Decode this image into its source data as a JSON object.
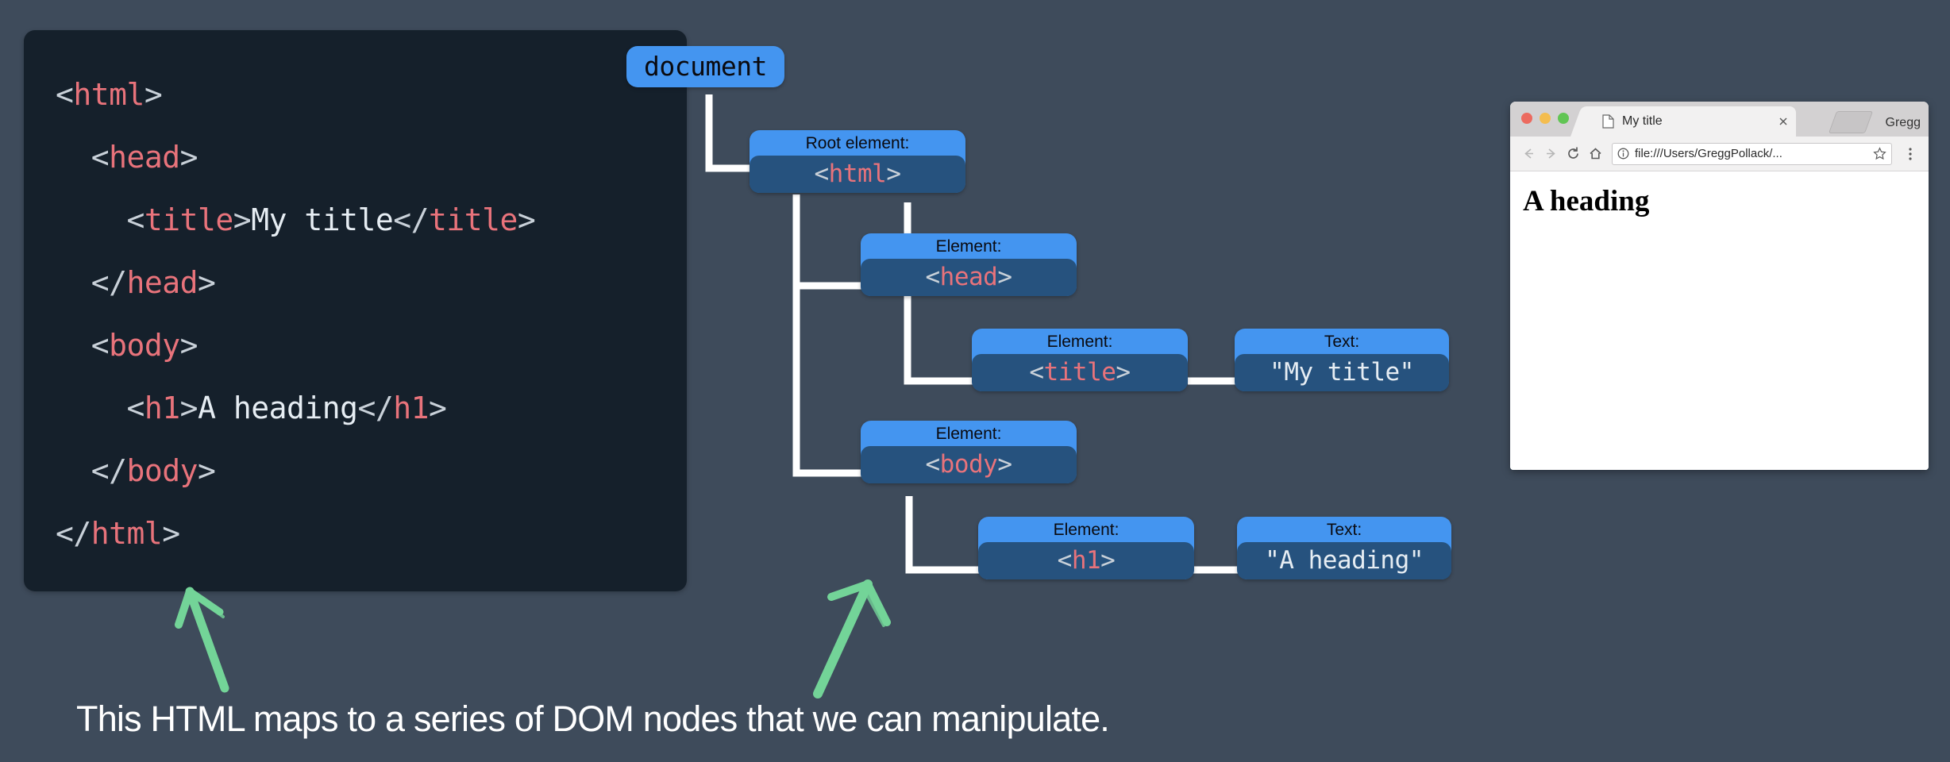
{
  "theme": {
    "background": "#3e4b5b",
    "code_background": "#15202b",
    "node_outer": "#4495f0",
    "node_inner": "#26527e",
    "tag_color": "#e8737b",
    "text_color": "#c9d1d9",
    "arrow_color": "#73d498",
    "caption_color": "#ffffff"
  },
  "code_panel": {
    "title": "html-source",
    "lines": [
      {
        "indent": 0,
        "parts": [
          {
            "t": "punc",
            "v": "<"
          },
          {
            "t": "tag",
            "v": "html"
          },
          {
            "t": "punc",
            "v": ">"
          }
        ]
      },
      {
        "indent": 1,
        "parts": [
          {
            "t": "punc",
            "v": "<"
          },
          {
            "t": "tag",
            "v": "head"
          },
          {
            "t": "punc",
            "v": ">"
          }
        ]
      },
      {
        "indent": 2,
        "parts": [
          {
            "t": "punc",
            "v": "<"
          },
          {
            "t": "tag",
            "v": "title"
          },
          {
            "t": "punc",
            "v": ">"
          },
          {
            "t": "txt",
            "v": "My title"
          },
          {
            "t": "punc",
            "v": "</"
          },
          {
            "t": "tag",
            "v": "title"
          },
          {
            "t": "punc",
            "v": ">"
          }
        ]
      },
      {
        "indent": 1,
        "parts": [
          {
            "t": "punc",
            "v": "</"
          },
          {
            "t": "tag",
            "v": "head"
          },
          {
            "t": "punc",
            "v": ">"
          }
        ]
      },
      {
        "indent": 1,
        "parts": [
          {
            "t": "punc",
            "v": "<"
          },
          {
            "t": "tag",
            "v": "body"
          },
          {
            "t": "punc",
            "v": ">"
          }
        ]
      },
      {
        "indent": 2,
        "parts": [
          {
            "t": "punc",
            "v": "<"
          },
          {
            "t": "tag",
            "v": "h1"
          },
          {
            "t": "punc",
            "v": ">"
          },
          {
            "t": "txt",
            "v": "A heading"
          },
          {
            "t": "punc",
            "v": "</"
          },
          {
            "t": "tag",
            "v": "h1"
          },
          {
            "t": "punc",
            "v": ">"
          }
        ]
      },
      {
        "indent": 1,
        "parts": [
          {
            "t": "punc",
            "v": "</"
          },
          {
            "t": "tag",
            "v": "body"
          },
          {
            "t": "punc",
            "v": ">"
          }
        ]
      },
      {
        "indent": 0,
        "parts": [
          {
            "t": "punc",
            "v": "</"
          },
          {
            "t": "tag",
            "v": "html"
          },
          {
            "t": "punc",
            "v": ">"
          }
        ]
      }
    ]
  },
  "tree": {
    "root_label": "document",
    "nodes": [
      {
        "id": "document",
        "label": "document",
        "code_parts": []
      },
      {
        "id": "html",
        "label": "Root element:",
        "code_parts": [
          {
            "t": "punc",
            "v": "<"
          },
          {
            "t": "tag",
            "v": "html"
          },
          {
            "t": "punc",
            "v": ">"
          }
        ]
      },
      {
        "id": "head",
        "label": "Element:",
        "code_parts": [
          {
            "t": "punc",
            "v": "<"
          },
          {
            "t": "tag",
            "v": "head"
          },
          {
            "t": "punc",
            "v": ">"
          }
        ]
      },
      {
        "id": "title",
        "label": "Element:",
        "code_parts": [
          {
            "t": "punc",
            "v": "<"
          },
          {
            "t": "tag",
            "v": "title"
          },
          {
            "t": "punc",
            "v": ">"
          }
        ]
      },
      {
        "id": "titletext",
        "label": "Text:",
        "code_parts": [
          {
            "t": "txt",
            "v": "\"My title\""
          }
        ]
      },
      {
        "id": "body",
        "label": "Element:",
        "code_parts": [
          {
            "t": "punc",
            "v": "<"
          },
          {
            "t": "tag",
            "v": "body"
          },
          {
            "t": "punc",
            "v": ">"
          }
        ]
      },
      {
        "id": "h1",
        "label": "Element:",
        "code_parts": [
          {
            "t": "punc",
            "v": "<"
          },
          {
            "t": "tag",
            "v": "h1"
          },
          {
            "t": "punc",
            "v": ">"
          }
        ]
      },
      {
        "id": "h1text",
        "label": "Text:",
        "code_parts": [
          {
            "t": "txt",
            "v": "\"A heading\""
          }
        ]
      }
    ]
  },
  "browser": {
    "traffic_lights": [
      "close",
      "minimize",
      "zoom"
    ],
    "tab": {
      "title": "My title",
      "favicon": "page-icon",
      "close": "close-icon"
    },
    "profile_name": "Gregg",
    "toolbar": {
      "back": "back-arrow-icon",
      "forward": "forward-arrow-icon",
      "reload": "reload-icon",
      "home": "home-icon",
      "info": "info-circle-icon",
      "url": "file:///Users/GreggPollack/...",
      "bookmark": "star-icon",
      "menu": "three-dot-menu-icon"
    },
    "page": {
      "heading": "A heading"
    }
  },
  "annotations": {
    "arrow_left": "green-arrow-up-left",
    "arrow_right": "green-arrow-up",
    "caption": "This HTML maps to a series of DOM nodes that we can manipulate."
  }
}
